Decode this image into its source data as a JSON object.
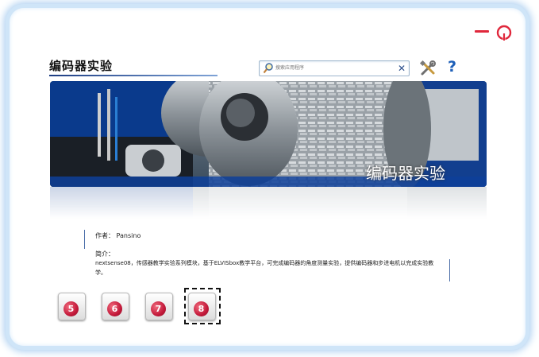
{
  "window": {
    "title": "编码器实验",
    "minimize_icon": "minimize-icon",
    "power_icon": "power-icon"
  },
  "search": {
    "placeholder": "搜索应用程序",
    "search_icon": "magnifier-icon",
    "clear_label": "✕"
  },
  "toolbar": {
    "tools_icon": "tools-icon",
    "help_label": "?"
  },
  "banner": {
    "caption": "编码器实验"
  },
  "info": {
    "author": "作者： Pansino",
    "intro_label": "简介：",
    "intro_text": "nextsense08，传感器教学实验系列模块，基于ELVISbox教学平台，可完成编码器的角度测量实验，提供编码器和步进电机以完成实验教学。"
  },
  "modules": [
    {
      "label": "5",
      "selected": false
    },
    {
      "label": "6",
      "selected": false
    },
    {
      "label": "7",
      "selected": false
    },
    {
      "label": "8",
      "selected": true
    }
  ],
  "colors": {
    "accent_red": "#e0283c",
    "help_blue": "#1e5fb8",
    "frame_glow": "#a9cdf0"
  }
}
